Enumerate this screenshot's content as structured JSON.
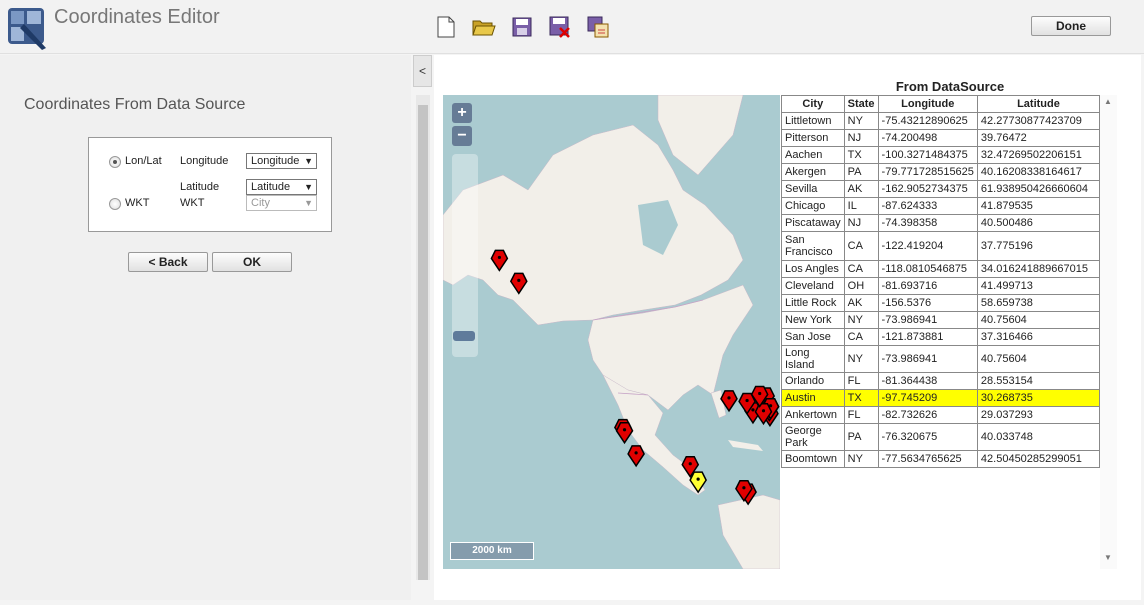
{
  "app": {
    "title": "Coordinates Editor"
  },
  "toolbar": {
    "icons": [
      "new-file-icon",
      "open-folder-icon",
      "save-icon",
      "save-as-icon",
      "export-icon"
    ],
    "done_label": "Done"
  },
  "left": {
    "title": "Coordinates From Data Source",
    "lonlat_label": "Lon/Lat",
    "wkt_label": "WKT",
    "longitude_label": "Longitude",
    "latitude_label": "Latitude",
    "wkt_field_label": "WKT",
    "longitude_value": "Longitude",
    "latitude_value": "Latitude",
    "wkt_value": "City",
    "selected_mode": "Lon/Lat",
    "back_label": "< Back",
    "ok_label": "OK",
    "collapse_label": "<"
  },
  "map": {
    "zoom_in": "+",
    "zoom_out": "−",
    "scale_label": "2000 km"
  },
  "table": {
    "title": "From DataSource",
    "headers": [
      "City",
      "State",
      "Longitude",
      "Latitude"
    ],
    "rows": [
      [
        "Littletown",
        "NY",
        "-75.43212890625",
        "42.27730877423709"
      ],
      [
        "Pitterson",
        "NJ",
        "-74.200498",
        "39.76472"
      ],
      [
        "Aachen",
        "TX",
        "-100.3271484375",
        "32.47269502206151"
      ],
      [
        "Akergen",
        "PA",
        "-79.771728515625",
        "40.16208338164617"
      ],
      [
        "Sevilla",
        "AK",
        "-162.9052734375",
        "61.938950426660604"
      ],
      [
        "Chicago",
        "IL",
        "-87.624333",
        "41.879535"
      ],
      [
        "Piscataway",
        "NJ",
        "-74.398358",
        "40.500486"
      ],
      [
        "San Francisco",
        "CA",
        "-122.419204",
        "37.775196"
      ],
      [
        "Los Angles",
        "CA",
        "-118.0810546875",
        "34.016241889667015"
      ],
      [
        "Cleveland",
        "OH",
        "-81.693716",
        "41.499713"
      ],
      [
        "Little Rock",
        "AK",
        "-156.5376",
        "58.659738"
      ],
      [
        "New York",
        "NY",
        "-73.986941",
        "40.75604"
      ],
      [
        "San Jose",
        "CA",
        "-121.873881",
        "37.316466"
      ],
      [
        "Long Island",
        "NY",
        "-73.986941",
        "40.75604"
      ],
      [
        "Orlando",
        "FL",
        "-81.364438",
        "28.553154"
      ],
      [
        "Austin",
        "TX",
        "-97.745209",
        "30.268735"
      ],
      [
        "Ankertown",
        "FL",
        "-82.732626",
        "29.037293"
      ],
      [
        "George Park",
        "PA",
        "-76.320675",
        "40.033748"
      ],
      [
        "Boomtown",
        "NY",
        "-77.5634765625",
        "42.50450285299051"
      ]
    ],
    "selected_row": "Austin"
  },
  "colors": {
    "marker": "#e00000",
    "marker_selected": "#ffff33",
    "row_highlight": "#ffff00",
    "ocean": "#aacbd0",
    "land": "#f2efe9"
  }
}
